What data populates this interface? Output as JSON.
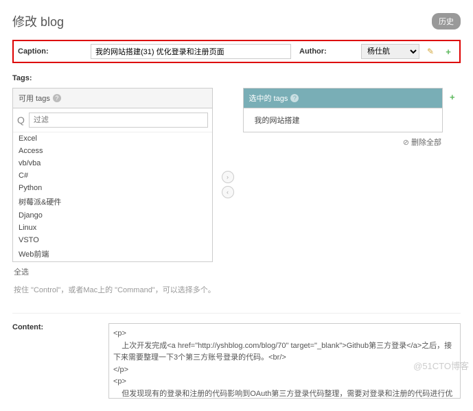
{
  "header": {
    "title": "修改 blog",
    "history_btn": "历史"
  },
  "caption_row": {
    "caption_label": "Caption:",
    "caption_value": "我的网站搭建(31) 优化登录和注册页面",
    "author_label": "Author:",
    "author_value": "杨仕航"
  },
  "tags": {
    "label": "Tags:",
    "available_title": "可用 tags",
    "selected_title": "选中的 tags",
    "filter_placeholder": "过滤",
    "available_items": [
      "Excel",
      "Access",
      "vb/vba",
      "C#",
      "Python",
      "树莓派&硬件",
      "Django",
      "Linux",
      "VSTO",
      "Web前端"
    ],
    "selected_items": [
      "我的网站搭建"
    ],
    "select_all": "全选",
    "remove_all": "删除全部",
    "hint": "按住 \"Control\"，或者Mac上的 \"Command\"，可以选择多个。"
  },
  "content": {
    "label": "Content:",
    "value": "<p>\n    上次开发完成<a href=\"http://yshblog.com/blog/70\" target=\"_blank\">Github第三方登录</a>之后，接下来需要整理一下3个第三方账号登录的代码。<br/>\n</p>\n<p>\n    但发现现有的登录和注册的代码影响到OAuth第三方登录代码整理，需要对登录和注册的代码进行优化。\n</p>\n<p>\n    之前写的登录、注册为了图方便就利用了Bootstrap的模态框。在最底层的模版页面加了两个form，"
  },
  "watermark": "@51CTO博客"
}
